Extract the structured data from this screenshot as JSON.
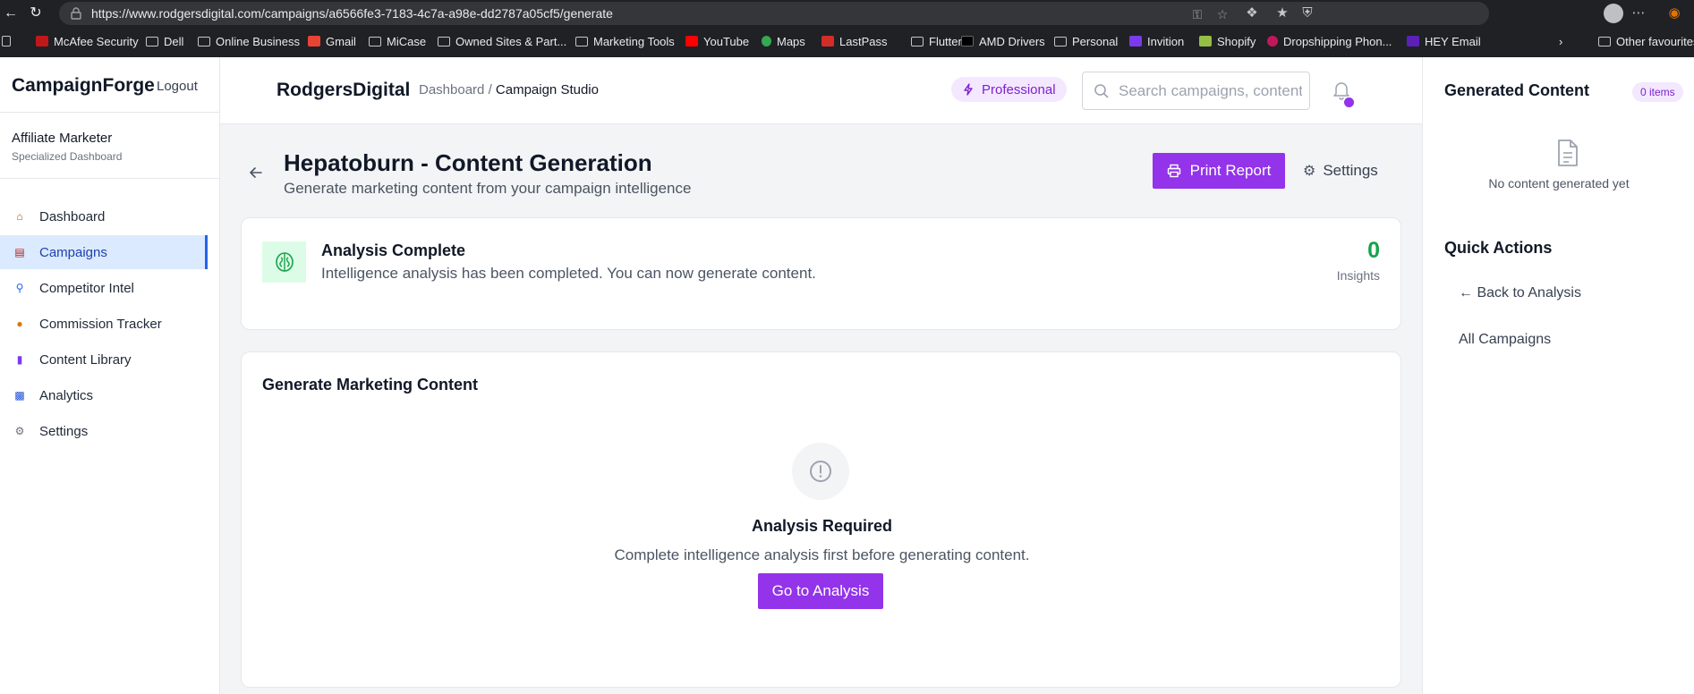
{
  "browser": {
    "url": "https://www.rodgersdigital.com/campaigns/a6566fe3-7183-4c7a-a98e-dd2787a05cf5/generate",
    "bookmarks": [
      {
        "label": "McAfee Security",
        "icon": "mcafee-icon"
      },
      {
        "label": "Dell",
        "icon": "folder-icon"
      },
      {
        "label": "Online Business",
        "icon": "folder-icon"
      },
      {
        "label": "Gmail",
        "icon": "gmail-icon"
      },
      {
        "label": "MiCase",
        "icon": "folder-icon"
      },
      {
        "label": "Owned Sites & Part...",
        "icon": "folder-icon"
      },
      {
        "label": "Marketing Tools",
        "icon": "folder-icon"
      },
      {
        "label": "YouTube",
        "icon": "youtube-icon"
      },
      {
        "label": "Maps",
        "icon": "maps-icon"
      },
      {
        "label": "LastPass",
        "icon": "lastpass-icon"
      },
      {
        "label": "Flutter",
        "icon": "folder-icon"
      },
      {
        "label": "AMD Drivers",
        "icon": "amd-icon"
      },
      {
        "label": "Personal",
        "icon": "folder-icon"
      },
      {
        "label": "Invition",
        "icon": "invition-icon"
      },
      {
        "label": "Shopify",
        "icon": "shopify-icon"
      },
      {
        "label": "Dropshipping Phon...",
        "icon": "dropshipping-icon"
      },
      {
        "label": "HEY Email",
        "icon": "hey-icon"
      }
    ],
    "other_favourites": "Other favourites"
  },
  "sidebar": {
    "brand": "CampaignForge",
    "logout": "Logout",
    "role_title": "Affiliate Marketer",
    "role_subtitle": "Specialized Dashboard",
    "items": [
      {
        "label": "Dashboard",
        "icon": "house-icon",
        "active": false
      },
      {
        "label": "Campaigns",
        "icon": "clipboard-icon",
        "active": true
      },
      {
        "label": "Competitor Intel",
        "icon": "magnifier-icon",
        "active": false
      },
      {
        "label": "Commission Tracker",
        "icon": "money-bag-icon",
        "active": false
      },
      {
        "label": "Content Library",
        "icon": "books-icon",
        "active": false
      },
      {
        "label": "Analytics",
        "icon": "bar-chart-icon",
        "active": false
      },
      {
        "label": "Settings",
        "icon": "gear-icon",
        "active": false
      }
    ]
  },
  "topbar": {
    "org_name": "RodgersDigital",
    "breadcrumb_root": "Dashboard",
    "breadcrumb_sep": "/",
    "breadcrumb_current": "Campaign Studio",
    "plan": "Professional",
    "search_placeholder": "Search campaigns, content..."
  },
  "page": {
    "title": "Hepatoburn - Content Generation",
    "subtitle": "Generate marketing content from your campaign intelligence",
    "print_label": "Print Report",
    "settings_label": "Settings"
  },
  "analysis_card": {
    "title": "Analysis Complete",
    "description": "Intelligence analysis has been completed. You can now generate content.",
    "insights_value": "0",
    "insights_label": "Insights"
  },
  "generate_card": {
    "title": "Generate Marketing Content",
    "required_title": "Analysis Required",
    "required_text": "Complete intelligence analysis first before generating content.",
    "button_label": "Go to Analysis"
  },
  "right_panel": {
    "title": "Generated Content",
    "count_badge": "0 items",
    "empty_text": "No content generated yet",
    "quick_actions_title": "Quick Actions",
    "back_link": "← Back to Analysis",
    "all_link": "All Campaigns"
  },
  "colors": {
    "accent": "#9333ea",
    "success": "#16a34a",
    "active_nav_bg": "#dbeafe",
    "active_nav_border": "#2563eb"
  }
}
